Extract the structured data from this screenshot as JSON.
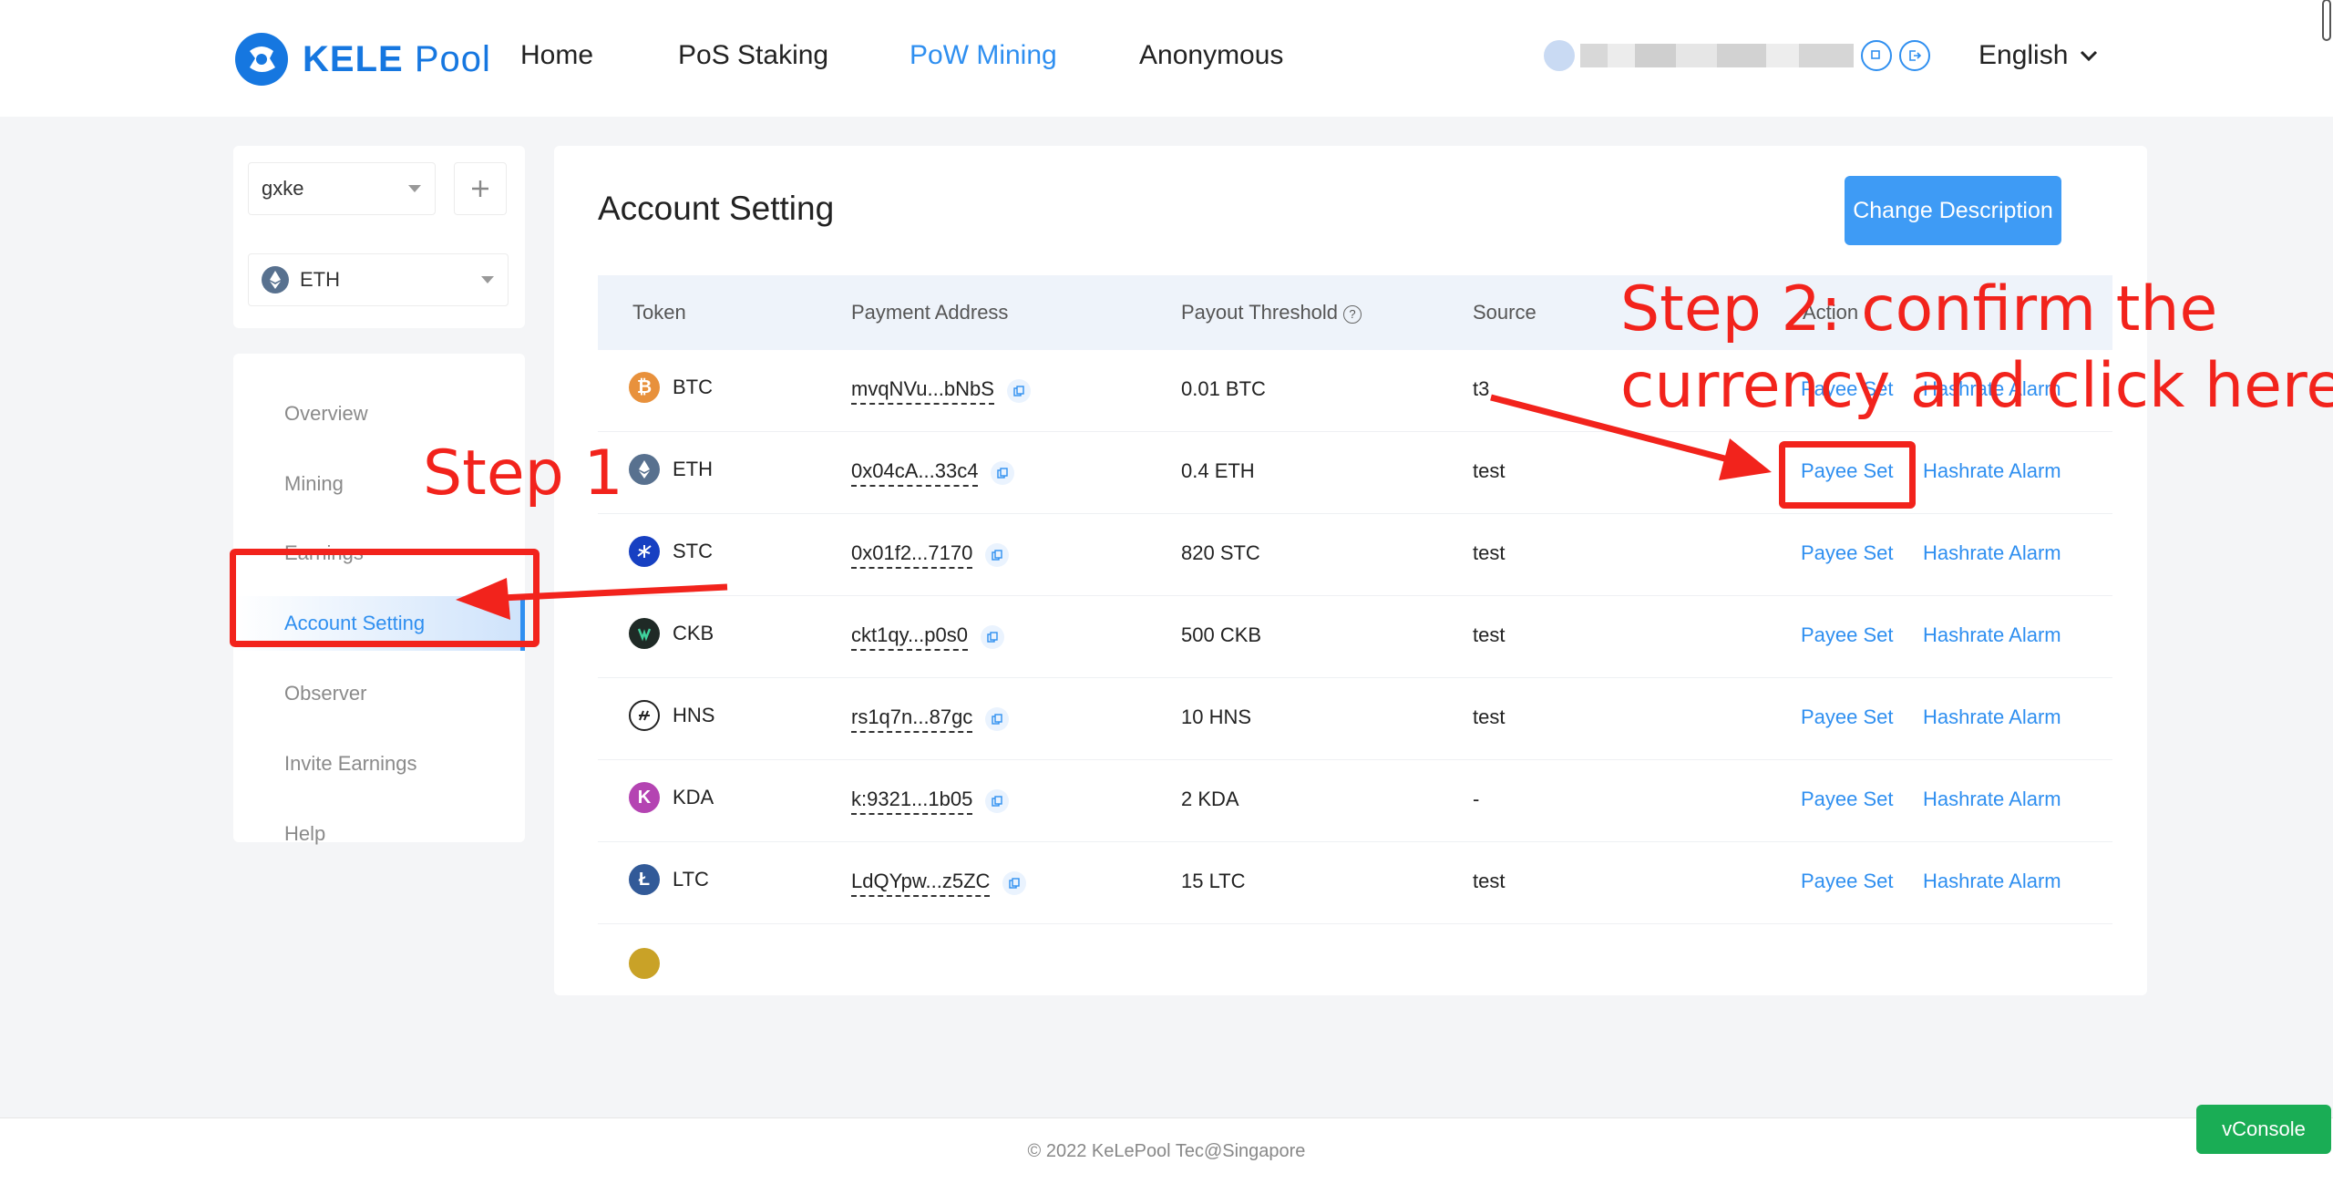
{
  "brand": {
    "name_bold": "KELE",
    "name_light": "Pool"
  },
  "nav": [
    {
      "label": "Home",
      "active": false
    },
    {
      "label": "PoS Staking",
      "active": false
    },
    {
      "label": "PoW Mining",
      "active": true
    },
    {
      "label": "Anonymous",
      "active": false
    }
  ],
  "language": "English",
  "sidebar": {
    "account": "gxke",
    "coin": "ETH",
    "menu": [
      {
        "label": "Overview",
        "active": false
      },
      {
        "label": "Mining",
        "active": false
      },
      {
        "label": "Earnings",
        "active": false
      },
      {
        "label": "Account Setting",
        "active": true
      },
      {
        "label": "Observer",
        "active": false
      },
      {
        "label": "Invite Earnings",
        "active": false
      },
      {
        "label": "Help",
        "active": false
      }
    ]
  },
  "main": {
    "title": "Account Setting",
    "change_button": "Change Description",
    "columns": {
      "token": "Token",
      "address": "Payment Address",
      "threshold": "Payout Threshold",
      "source": "Source",
      "action": "Action"
    },
    "rows": [
      {
        "token": "BTC",
        "address": "mvqNVu...bNbS",
        "threshold": "0.01 BTC",
        "source": "t3",
        "action1": "Payee Set",
        "action2": "Hashrate Alarm",
        "color": "#e8913c"
      },
      {
        "token": "ETH",
        "address": "0x04cA...33c4",
        "threshold": "0.4 ETH",
        "source": "test",
        "action1": "Payee Set",
        "action2": "Hashrate Alarm",
        "color": "#58718f"
      },
      {
        "token": "STC",
        "address": "0x01f2...7170",
        "threshold": "820 STC",
        "source": "test",
        "action1": "Payee Set",
        "action2": "Hashrate Alarm",
        "color": "#1740c2"
      },
      {
        "token": "CKB",
        "address": "ckt1qy...p0s0",
        "threshold": "500 CKB",
        "source": "test",
        "action1": "Payee Set",
        "action2": "Hashrate Alarm",
        "color": "#1f2a26"
      },
      {
        "token": "HNS",
        "address": "rs1q7n...87gc",
        "threshold": "10 HNS",
        "source": "test",
        "action1": "Payee Set",
        "action2": "Hashrate Alarm",
        "color": "#ffffff"
      },
      {
        "token": "KDA",
        "address": "k:9321...1b05",
        "threshold": "2 KDA",
        "source": "-",
        "action1": "Payee Set",
        "action2": "Hashrate Alarm",
        "color": "#b444b2"
      },
      {
        "token": "LTC",
        "address": "LdQYpw...z5ZC",
        "threshold": "15 LTC",
        "source": "test",
        "action1": "Payee Set",
        "action2": "Hashrate Alarm",
        "color": "#325a98"
      }
    ]
  },
  "annotations": {
    "step1": "Step 1",
    "step2_line1": "Step 2: confirm the",
    "step2_line2": "currency and click here"
  },
  "footer": "© 2022 KeLePool Tec@Singapore",
  "vconsole": "vConsole"
}
